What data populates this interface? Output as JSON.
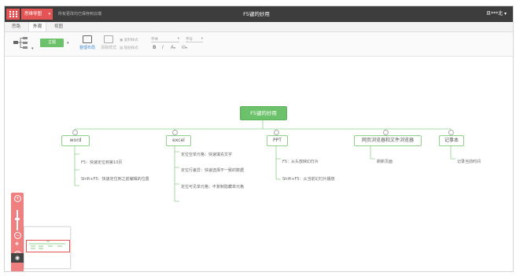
{
  "topbar": {
    "app_menu_label": "思维导图",
    "save_status": "所有更改均已保存到云端",
    "doc_title": "F5键的妙用",
    "user_name": "旦***北"
  },
  "tabs": [
    {
      "label": "思路"
    },
    {
      "label": "外观"
    },
    {
      "label": "视图"
    }
  ],
  "toolbar": {
    "theme_label": "主题",
    "layout_label": "整理布局",
    "clear_format_label": "清除样式",
    "copy_style_label": "复制样式",
    "paste_style_label": "粘贴样式",
    "font_placeholder": "字体",
    "font_size_placeholder": "字号",
    "bold": "B",
    "italic": "I",
    "font_color": "A"
  },
  "mindmap": {
    "root": "F5键的妙用",
    "branches": [
      {
        "label": "word",
        "leaves": [
          "F5：快速定位到第10页",
          "Shift+F5：快速定位到之前编辑的位置"
        ]
      },
      {
        "label": "excel",
        "leaves": [
          "定位空单元格：快速填充文字",
          "定位行差异：快速选择不一致的数据",
          "定位可见单元格：不复制隐藏单元格"
        ]
      },
      {
        "label": "PPT",
        "leaves": [
          "F5：从头放映幻灯片",
          "Shift+F5：从当前幻灯片播放"
        ]
      },
      {
        "label": "网页浏览器和文件浏览器",
        "leaves": [
          "刷新页面"
        ]
      },
      {
        "label": "记事本",
        "leaves": [
          "记录当前时间"
        ]
      }
    ]
  },
  "colors": {
    "accent": "#e55454",
    "node_green": "#6cc26a",
    "topbar": "#3d3d3d"
  }
}
